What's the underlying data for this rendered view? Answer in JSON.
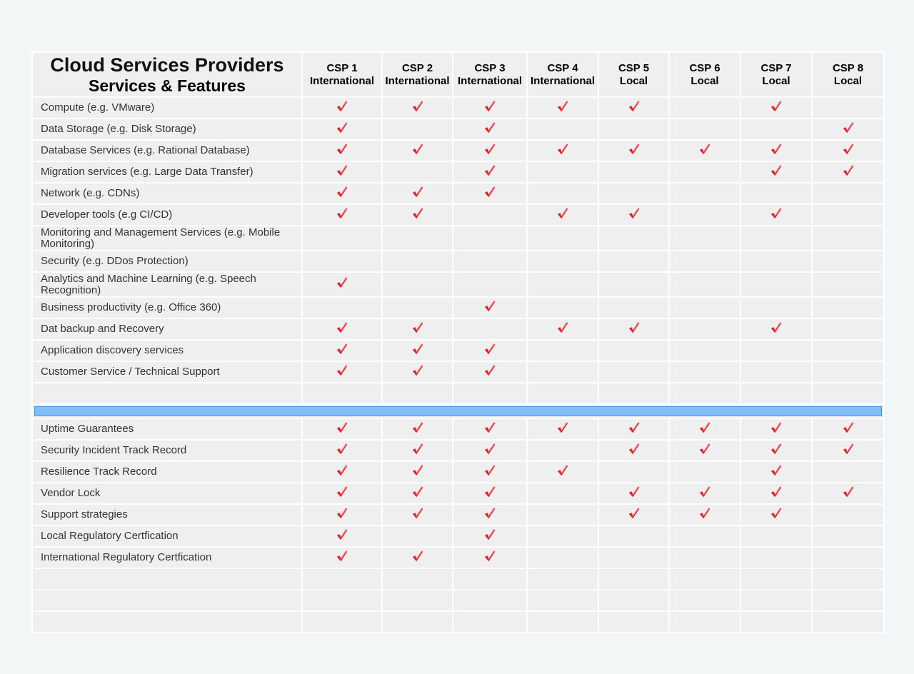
{
  "header": {
    "title": "Cloud Services Providers",
    "subtitle": "Services & Features"
  },
  "providers": [
    {
      "name": "CSP 1",
      "type": "International"
    },
    {
      "name": "CSP 2",
      "type": "International"
    },
    {
      "name": "CSP 3",
      "type": "International"
    },
    {
      "name": "CSP 4",
      "type": "International"
    },
    {
      "name": "CSP 5",
      "type": "Local"
    },
    {
      "name": "CSP 6",
      "type": "Local"
    },
    {
      "name": "CSP 7",
      "type": "Local"
    },
    {
      "name": "CSP 8",
      "type": "Local"
    }
  ],
  "check_icon": "red-checkmark-icon",
  "colors": {
    "check": "#e8202a",
    "separator_fill": "#7fbdfb",
    "separator_border": "#4a95e0"
  },
  "services": [
    {
      "label": "Compute (e.g. VMware)",
      "checks": [
        1,
        1,
        1,
        1,
        1,
        0,
        1,
        0
      ]
    },
    {
      "label": "Data Storage (e.g. Disk Storage)",
      "checks": [
        1,
        0,
        1,
        0,
        0,
        0,
        0,
        1
      ]
    },
    {
      "label": "Database Services (e.g. Rational Database)",
      "checks": [
        1,
        1,
        1,
        1,
        1,
        1,
        1,
        1
      ]
    },
    {
      "label": "Migration services (e.g. Large Data Transfer)",
      "checks": [
        1,
        0,
        1,
        0,
        0,
        0,
        1,
        1
      ]
    },
    {
      "label": "Network (e.g. CDNs)",
      "checks": [
        1,
        1,
        1,
        0,
        0,
        0,
        0,
        0
      ]
    },
    {
      "label": "Developer tools (e.g CI/CD)",
      "checks": [
        1,
        1,
        0,
        1,
        1,
        0,
        1,
        0
      ]
    },
    {
      "label": "Monitoring and Management Services (e.g. Mobile Monitoring)",
      "checks": [
        0,
        0,
        0,
        0,
        0,
        0,
        0,
        0
      ]
    },
    {
      "label": "Security (e.g. DDos Protection)",
      "checks": [
        0,
        0,
        0,
        0,
        0,
        0,
        0,
        0
      ]
    },
    {
      "label": "Analytics and Machine Learning (e.g. Speech Recognition)",
      "checks": [
        1,
        0,
        0,
        0,
        0,
        0,
        0,
        0
      ]
    },
    {
      "label": "Business productivity (e.g. Office 360)",
      "checks": [
        0,
        0,
        1,
        0,
        0,
        0,
        0,
        0
      ]
    },
    {
      "label": "Dat backup and Recovery",
      "checks": [
        1,
        1,
        0,
        1,
        1,
        0,
        1,
        0
      ]
    },
    {
      "label": "Application discovery services",
      "checks": [
        1,
        1,
        1,
        0,
        0,
        0,
        0,
        0
      ]
    },
    {
      "label": "Customer Service / Technical Support",
      "checks": [
        1,
        1,
        1,
        0,
        0,
        0,
        0,
        0
      ]
    }
  ],
  "features": [
    {
      "label": "Uptime Guarantees",
      "checks": [
        1,
        1,
        1,
        1,
        1,
        1,
        1,
        1
      ]
    },
    {
      "label": "Security Incident Track Record",
      "checks": [
        1,
        1,
        1,
        0,
        1,
        1,
        1,
        1
      ]
    },
    {
      "label": "Resilience Track Record",
      "checks": [
        1,
        1,
        1,
        1,
        0,
        0,
        1,
        0
      ]
    },
    {
      "label": "Vendor Lock",
      "checks": [
        1,
        1,
        1,
        0,
        1,
        1,
        1,
        1
      ]
    },
    {
      "label": "Support strategies",
      "checks": [
        1,
        1,
        1,
        0,
        1,
        1,
        1,
        0
      ]
    },
    {
      "label": "Local Regulatory Certfication",
      "checks": [
        1,
        0,
        1,
        0,
        0,
        0,
        0,
        0
      ]
    },
    {
      "label": "International Regulatory Certfication",
      "checks": [
        1,
        1,
        1,
        0,
        0,
        0,
        0,
        0
      ]
    }
  ],
  "blank_rows_after_services": 1,
  "blank_rows_at_end": 3
}
